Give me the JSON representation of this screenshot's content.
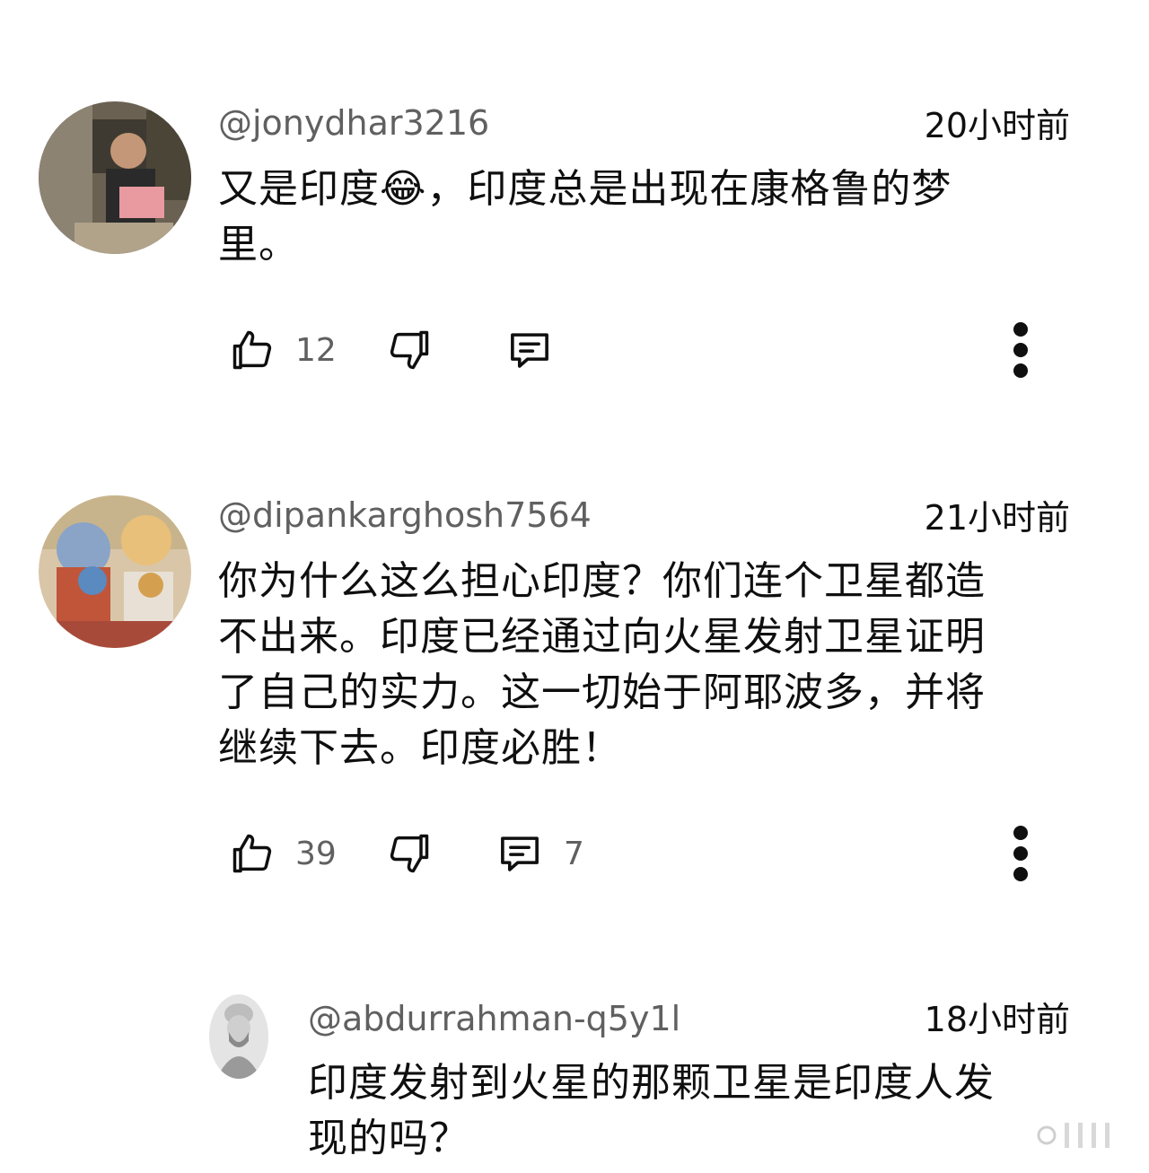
{
  "comments": [
    {
      "handle": "@jonydhar3216",
      "time": "20小时前",
      "text_lines": [
        "又是印度😂，印度总是出现在康格鲁的梦",
        "里。"
      ],
      "likes": "12",
      "replies": ""
    },
    {
      "handle": "@dipankarghosh7564",
      "time": "21小时前",
      "text_lines": [
        "你为什么这么担心印度？你们连个卫星都造",
        "不出来。印度已经通过向火星发射卫星证明",
        "了自己的实力。这一切始于阿耶波多，并将",
        "继续下去。印度必胜！"
      ],
      "likes": "39",
      "replies": "7"
    },
    {
      "handle": "@abdurrahman-q5y1l",
      "time": "18小时前",
      "text_lines": [
        "印度发射到火星的那颗卫星是印度人发",
        "现的吗？"
      ]
    }
  ],
  "icons": {
    "like": "thumbs-up-icon",
    "dislike": "thumbs-down-icon",
    "reply": "comment-bubble-icon",
    "more": "vertical-dots-icon"
  },
  "colors": {
    "text": "#0f0f0f",
    "secondary": "#606060",
    "background": "#ffffff"
  }
}
